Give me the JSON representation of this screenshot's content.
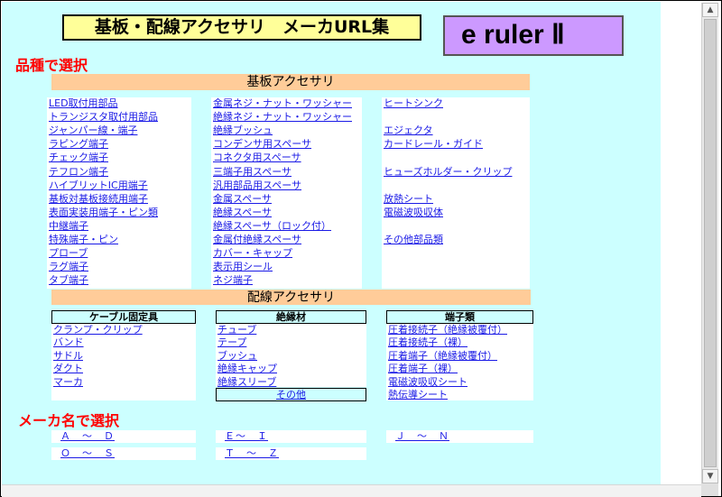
{
  "title": "基板・配線アクセサリ　メーカURL集",
  "logo": "e ruler Ⅱ",
  "section_category": "品種で選択",
  "section_maker": "メーカ名で選択",
  "board": {
    "header": "基板アクセサリ",
    "col1": [
      "LED取付用部品",
      "トランジスタ取付用部品",
      "ジャンパー線・端子",
      "ラピング端子",
      "チェック端子",
      "テフロン端子",
      "ハイブリットIC用端子",
      "基板対基板接続用端子",
      "表面実装用端子・ピン類",
      "中継端子",
      "特殊端子・ピン",
      "プローブ",
      "ラグ端子",
      "タブ端子"
    ],
    "col2": [
      "金属ネジ・ナット・ワッシャー",
      "絶縁ネジ・ナット・ワッシャー",
      "絶縁ブッシュ",
      "コンデンサ用スペーサ",
      "コネクタ用スペーサ",
      "三端子用スペーサ",
      "汎用部品用スペーサ",
      "金属スペーサ",
      "絶縁スペーサ",
      "絶縁スペーサ（ロック付）",
      "金属付絶縁スペーサ",
      "カバー・キャップ",
      "表示用シール",
      "ネジ端子"
    ],
    "col3": [
      "ヒートシンク",
      "",
      "エジェクタ",
      "カードレール・ガイド",
      "",
      "ヒューズホルダー・クリップ",
      "",
      "放熱シート",
      "電磁波吸収体",
      "",
      "その他部品類"
    ]
  },
  "wiring": {
    "header": "配線アクセサリ",
    "cable_header": "ケーブル固定具",
    "cable": [
      "クランプ・クリップ",
      "バンド",
      "サドル",
      "ダクト",
      "マーカ"
    ],
    "insul_header": "絶縁材",
    "insul": [
      "チューブ",
      "テープ",
      "ブッシュ",
      "絶縁キャップ",
      "絶縁スリーブ"
    ],
    "insul_other": "その他",
    "term_header": "端子類",
    "term": [
      "圧着接続子（絶縁被覆付）",
      "圧着接続子（裸）",
      "圧着端子（絶縁被覆付）",
      "圧着端子（裸）",
      "電磁波吸収シート",
      "熱伝導シート"
    ]
  },
  "makers": {
    "a_d": "Ａ　～　Ｄ",
    "e_i": "Ｅ～　Ｉ",
    "j_n": "Ｊ　～　Ｎ",
    "o_s": "Ｏ　～　Ｓ",
    "t_z": "Ｔ　～　Ｚ"
  }
}
